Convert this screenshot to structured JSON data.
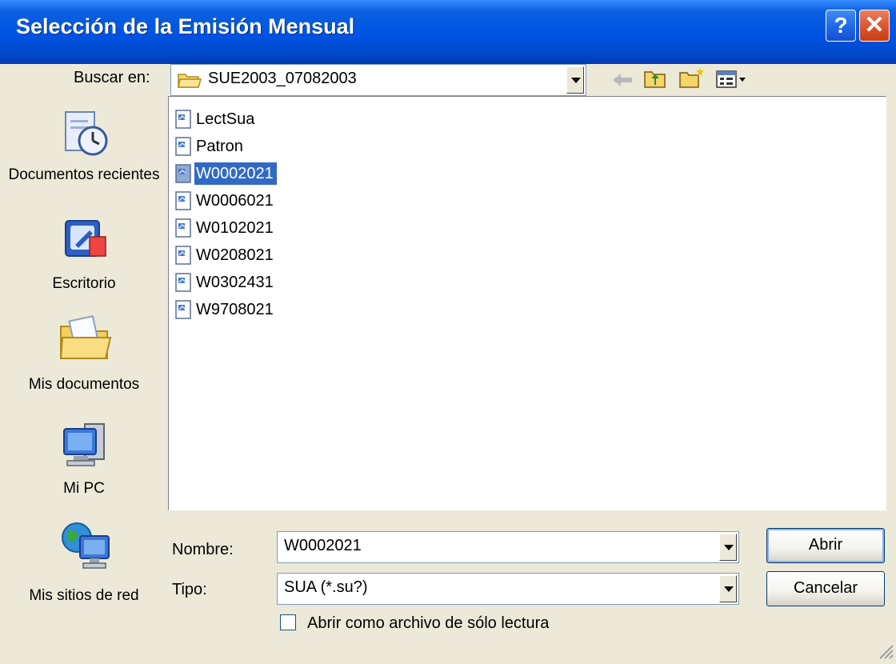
{
  "window": {
    "title": "Selección de la Emisión Mensual",
    "help_glyph": "?",
    "close_glyph": "✕"
  },
  "lookin": {
    "label": "Buscar en:",
    "value": "SUE2003_07082003"
  },
  "places": [
    {
      "label": "Documentos recientes",
      "icon": "recent-documents-icon"
    },
    {
      "label": "Escritorio",
      "icon": "desktop-icon"
    },
    {
      "label": "Mis documentos",
      "icon": "my-documents-icon"
    },
    {
      "label": "Mi PC",
      "icon": "my-computer-icon"
    },
    {
      "label": "Mis sitios de red",
      "icon": "network-places-icon"
    }
  ],
  "files": [
    {
      "name": "LectSua",
      "selected": false
    },
    {
      "name": "Patron",
      "selected": false
    },
    {
      "name": "W0002021",
      "selected": true
    },
    {
      "name": "W0006021",
      "selected": false
    },
    {
      "name": "W0102021",
      "selected": false
    },
    {
      "name": "W0208021",
      "selected": false
    },
    {
      "name": "W0302431",
      "selected": false
    },
    {
      "name": "W9708021",
      "selected": false
    }
  ],
  "filename": {
    "label": "Nombre:",
    "value": "W0002021"
  },
  "filetype": {
    "label": "Tipo:",
    "value": "SUA (*.su?)"
  },
  "readonly": {
    "label": "Abrir como archivo de sólo lectura",
    "checked": false
  },
  "buttons": {
    "open": "Abrir",
    "cancel": "Cancelar"
  },
  "colors": {
    "titlebar": "#0054e3",
    "selection": "#316ac5",
    "dialog_bg": "#ece9d8"
  }
}
